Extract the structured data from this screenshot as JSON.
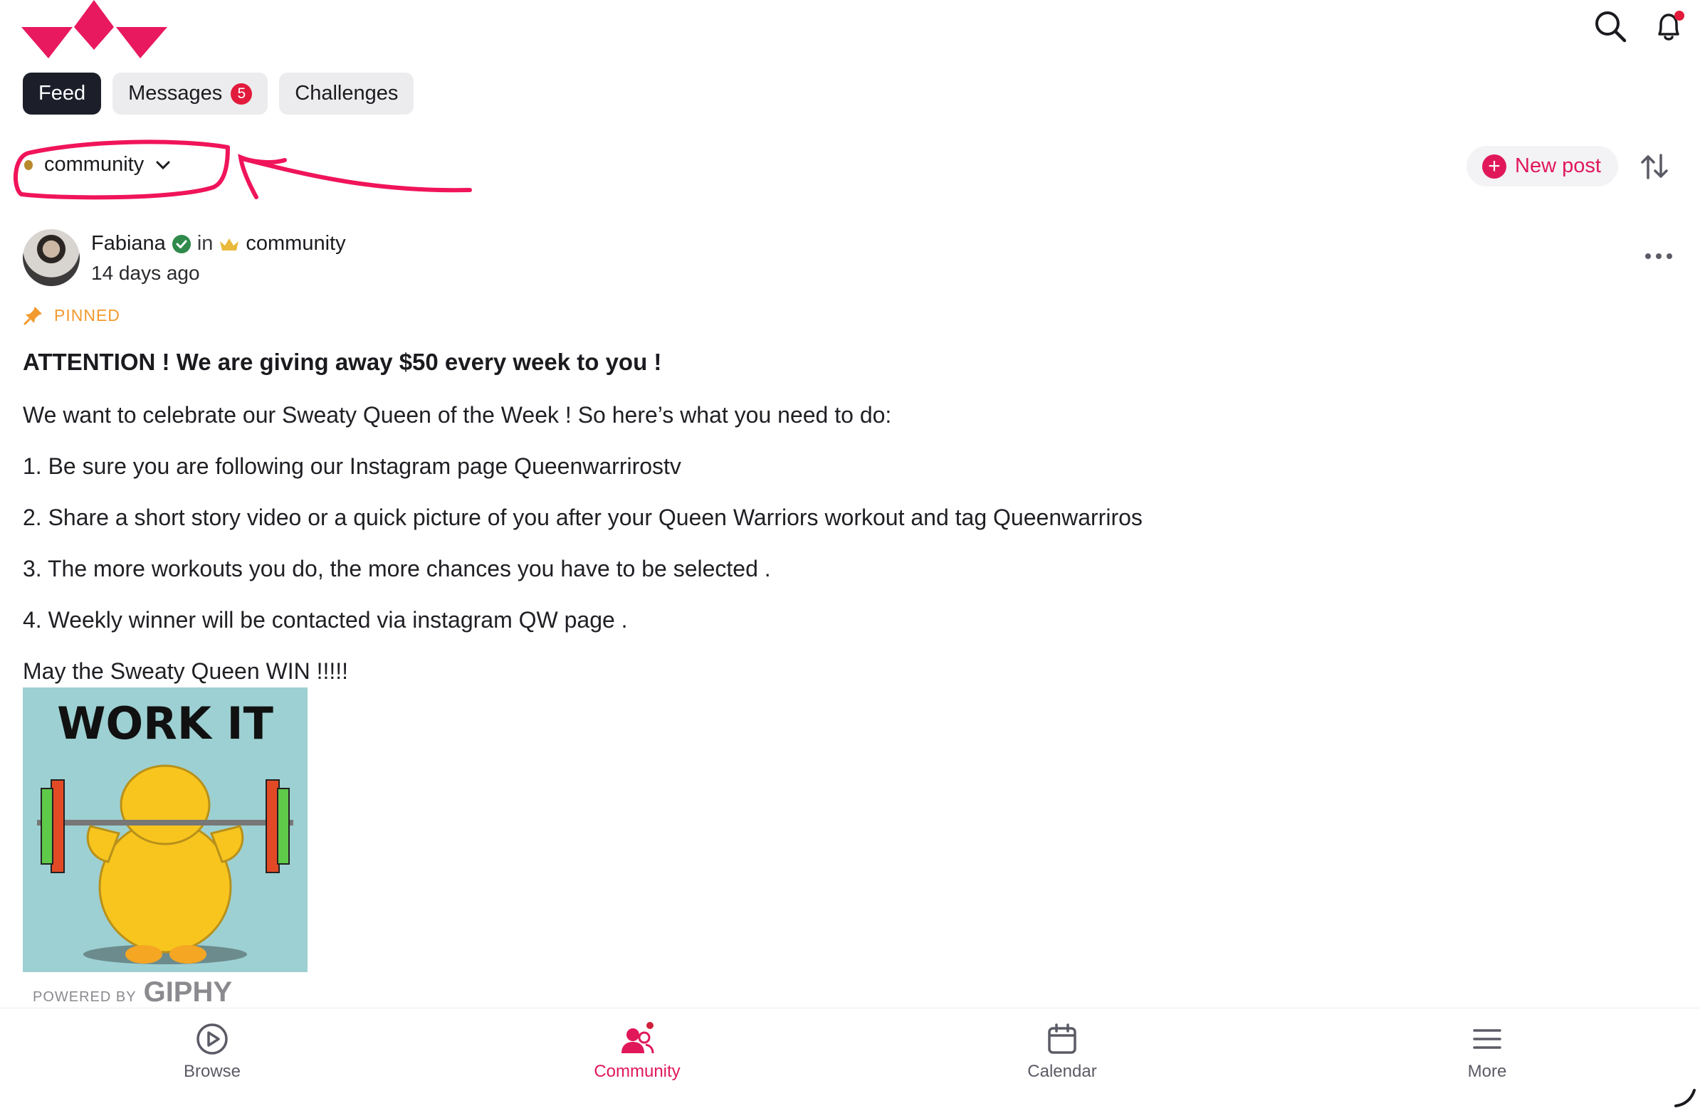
{
  "header": {
    "logo": "crown-logo",
    "icons": {
      "search": "search-icon",
      "notifications": "bell-icon"
    },
    "colors": {
      "brand": "#e0185a",
      "notification_dot": "#e21b3c"
    }
  },
  "tabs": [
    {
      "label": "Feed",
      "active": true
    },
    {
      "label": "Messages",
      "badge": "5",
      "active": false
    },
    {
      "label": "Challenges",
      "active": false
    }
  ],
  "space_selector": {
    "label": "community"
  },
  "actions": {
    "new_post_label": "New post",
    "sort_icon": "sort-icon"
  },
  "post": {
    "author": "Fabiana",
    "in_text": "in",
    "space": "community",
    "time": "14 days ago",
    "pinned_label": "PINNED",
    "title": "ATTENTION ! We are giving away $50 every week to you !",
    "lines": [
      "We want to celebrate our Sweaty Queen of the Week ! So here’s what you need to do:",
      "1. Be sure you are following our Instagram page Queenwarrirostv",
      "2. Share a short story video or a quick picture of you after your Queen Warriors workout and tag Queenwarriros",
      "3. The more workouts you do, the more chances you have to be selected .",
      "4. Weekly winner will be contacted via instagram QW page .",
      "May the Sweaty Queen WIN !!!!!"
    ],
    "gif_text": "WORK IT",
    "powered_by": "POWERED BY",
    "giphy": "GIPHY"
  },
  "bottom_nav": [
    {
      "label": "Browse",
      "icon": "play-circle-icon",
      "active": false
    },
    {
      "label": "Community",
      "icon": "community-icon",
      "active": true
    },
    {
      "label": "Calendar",
      "icon": "calendar-icon",
      "active": false
    },
    {
      "label": "More",
      "icon": "menu-icon",
      "active": false
    }
  ]
}
